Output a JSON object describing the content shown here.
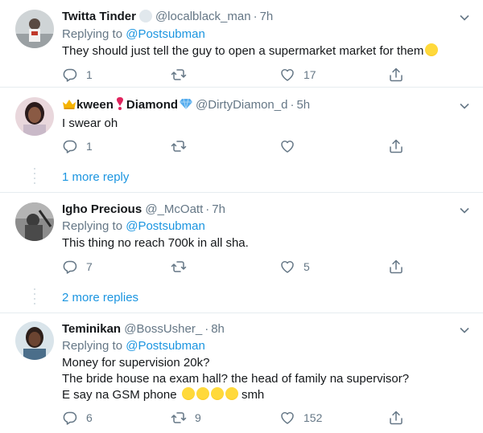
{
  "tweets": [
    {
      "name": "Twitta Tinder",
      "handle": "@localblack_man",
      "time": "7h",
      "reply_label": "Replying to",
      "reply_mention": "@Postsubman",
      "text_lines": [
        "They should just tell the guy to open a supermarket market for them"
      ],
      "replies": "1",
      "retweets": "",
      "likes": "17"
    },
    {
      "name": "kween",
      "name_suffix": "Diamond",
      "handle": "@DirtyDiamon_d",
      "time": "5h",
      "text_lines": [
        "I swear oh"
      ],
      "replies": "1",
      "retweets": "",
      "likes": "",
      "more_replies": "1 more reply"
    },
    {
      "name": "Igho Precious",
      "handle": "@_McOatt",
      "time": "7h",
      "reply_label": "Replying to",
      "reply_mention": "@Postsubman",
      "text_lines": [
        "This thing no reach 700k in all sha."
      ],
      "replies": "7",
      "retweets": "",
      "likes": "5",
      "more_replies": "2 more replies"
    },
    {
      "name": "Teminikan",
      "handle": "@BossUsher_",
      "time": "8h",
      "reply_label": "Replying to",
      "reply_mention": "@Postsubman",
      "text_lines": [
        "Money for supervision 20k?",
        "The bride house na exam hall? the head of family na supervisor?",
        "E say na GSM phone",
        "smh"
      ],
      "replies": "6",
      "retweets": "9",
      "likes": "152"
    }
  ],
  "icons": {
    "reply": "reply-icon",
    "retweet": "retweet-icon",
    "like": "heart-icon",
    "share": "share-icon",
    "menu": "chevron-down-icon"
  },
  "colors": {
    "link": "#1b95e0",
    "muted": "#657786",
    "border": "#e6ecf0"
  }
}
